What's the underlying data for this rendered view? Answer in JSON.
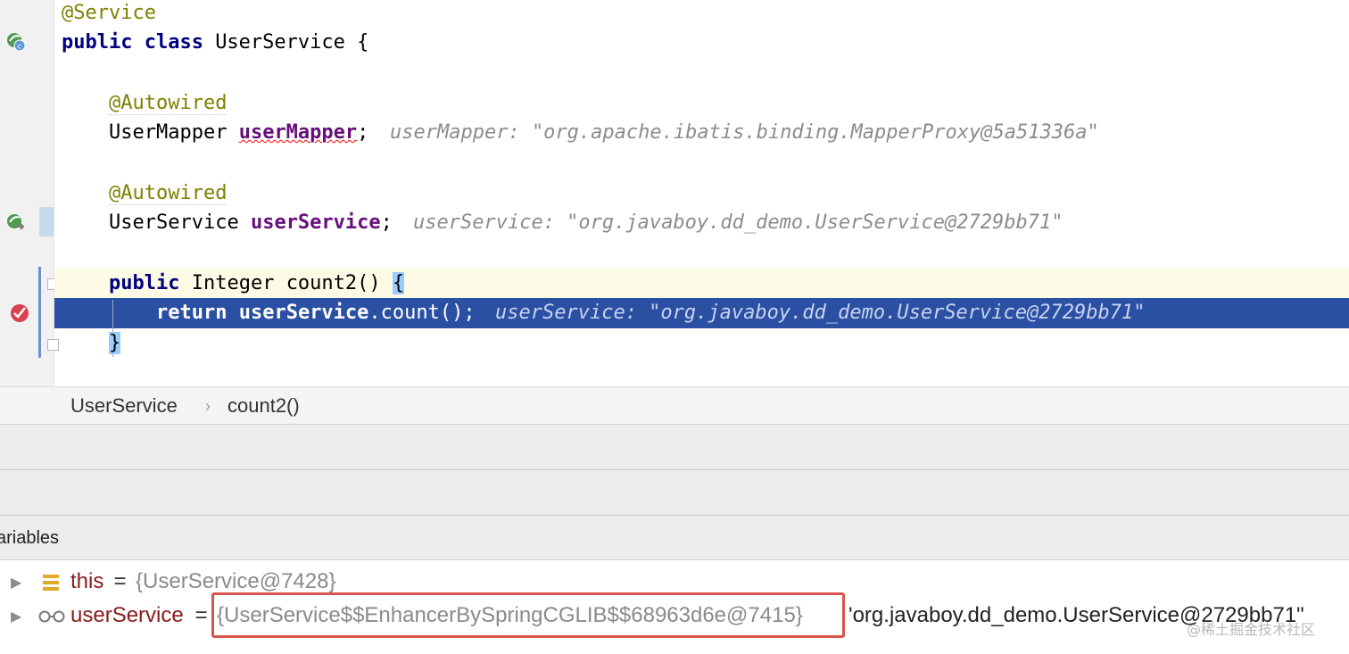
{
  "editor": {
    "lines": {
      "service_annotation": "@Service",
      "class_kw": "public class ",
      "class_name": "UserService {",
      "autowired_1": "@Autowired",
      "mapper_type": "UserMapper ",
      "mapper_field": "userMapper",
      "mapper_semicolon": ";",
      "mapper_hint": "userMapper: \"org.apache.ibatis.binding.MapperProxy@5a51336a\"",
      "autowired_2": "@Autowired",
      "service_type": "UserService ",
      "service_field": "userService",
      "service_semicolon": ";",
      "service_hint": "userService: \"org.javaboy.dd_demo.UserService@2729bb71\"",
      "method_kw": "public",
      "method_sig": " Integer count2() ",
      "method_brace": "{",
      "return_kw": "return ",
      "return_field": "userService",
      "return_call": ".count();",
      "return_hint": "userService: \"org.javaboy.dd_demo.UserService@2729bb71\"",
      "close_brace": "}"
    },
    "gutter_icons": {
      "class_icon": "spring-bean-class-icon",
      "injection_icon": "spring-bean-injection-icon",
      "breakpoint_icon": "breakpoint-check-icon"
    }
  },
  "breadcrumb": {
    "items": [
      "UserService",
      "count2()"
    ],
    "separator": "›"
  },
  "variables": {
    "title": "ariables",
    "rows": [
      {
        "name": "this",
        "eq": " = ",
        "type": "{UserService@7428}",
        "value": "",
        "icon": "field-stack-icon"
      },
      {
        "name": "userService",
        "eq": " = ",
        "type": "{UserService$$EnhancerBySpringCGLIB$$68963d6e@7415}",
        "value": "'org.javaboy.dd_demo.UserService@2729bb71\"",
        "icon": "watch-glasses-icon"
      }
    ]
  },
  "watermark": "@稀土掘金技术社区",
  "colors": {
    "exec_line_bg": "#2b50a3",
    "keyword": "#000080",
    "annotation": "#808000",
    "field": "#660e7a",
    "highlight_box": "#d9534f"
  }
}
